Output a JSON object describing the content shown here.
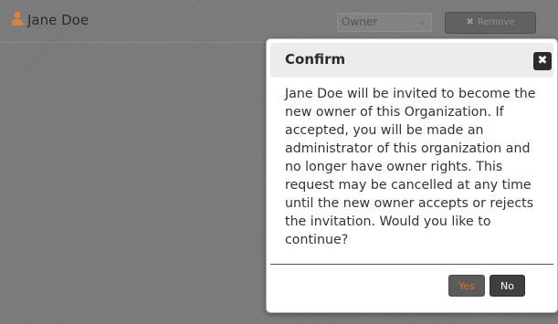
{
  "member_row": {
    "user_icon": "person-icon",
    "user_name": "Jane Doe",
    "role_select": {
      "value": "Owner",
      "chevron_icon": "chevron-down-icon"
    },
    "remove_button": {
      "icon": "close-icon",
      "label": "Remove"
    }
  },
  "dialog": {
    "title": "Confirm",
    "close_icon": "close-icon",
    "close_glyph": "✖",
    "message": "Jane Doe will be invited to become the new owner of this Organization. If accepted, you will be made an administrator of this organization and no longer have owner rights. This request may be cancelled at any time until the new owner accepts or rejects the invitation. Would you like to continue?",
    "yes_label": "Yes",
    "no_label": "No"
  },
  "colors": {
    "accent_orange": "#e76a27",
    "user_icon": "#d9823f",
    "overlay": "#777777",
    "dialog_bg": "#ffffff",
    "header_bg": "#ececec"
  }
}
